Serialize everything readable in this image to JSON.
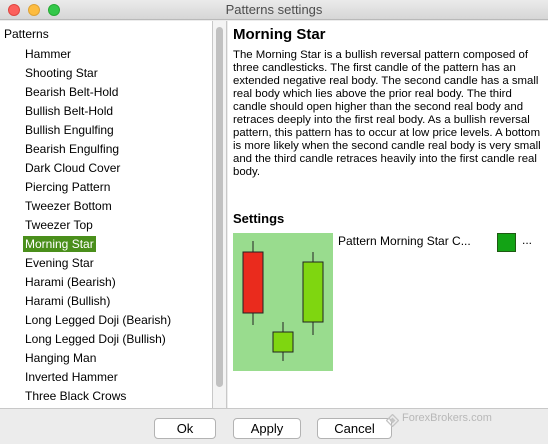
{
  "window": {
    "title": "Patterns settings"
  },
  "tree": {
    "root_label": "Patterns",
    "items": [
      "Hammer",
      "Shooting Star",
      "Bearish Belt-Hold",
      "Bullish Belt-Hold",
      "Bullish Engulfing",
      "Bearish Engulfing",
      "Dark Cloud Cover",
      "Piercing Pattern",
      "Tweezer Bottom",
      "Tweezer Top",
      "Morning Star",
      "Evening Star",
      "Harami (Bearish)",
      "Harami (Bullish)",
      "Long Legged Doji (Bearish)",
      "Long Legged Doji (Bullish)",
      "Hanging Man",
      "Inverted Hammer",
      "Three Black Crows"
    ],
    "selected": "Morning Star"
  },
  "pattern": {
    "title": "Morning Star",
    "description": "The Morning Star is a bullish reversal pattern composed of three candlesticks. The first candle of the pattern has an extended negative real body. The second candle has a small real body which lies above the prior real body. The third candle should open higher than the second real body and retraces deeply into the first real body. As a bullish reversal pattern, this pattern has to occur at low price levels. A bottom is more likely when the second candle real body is very small and the third candle retraces heavily into the first candle real body."
  },
  "settings": {
    "header": "Settings",
    "label": "Pattern Morning Star C...",
    "color_swatch": "#13a315",
    "more": "...",
    "preview_bg": "#99dc8e",
    "candle_colors": {
      "bear": "#ea2b1d",
      "bull": "#7fd610"
    }
  },
  "buttons": {
    "ok": "Ok",
    "apply": "Apply",
    "cancel": "Cancel"
  },
  "watermark": {
    "text": "ForexBrokers.com"
  }
}
